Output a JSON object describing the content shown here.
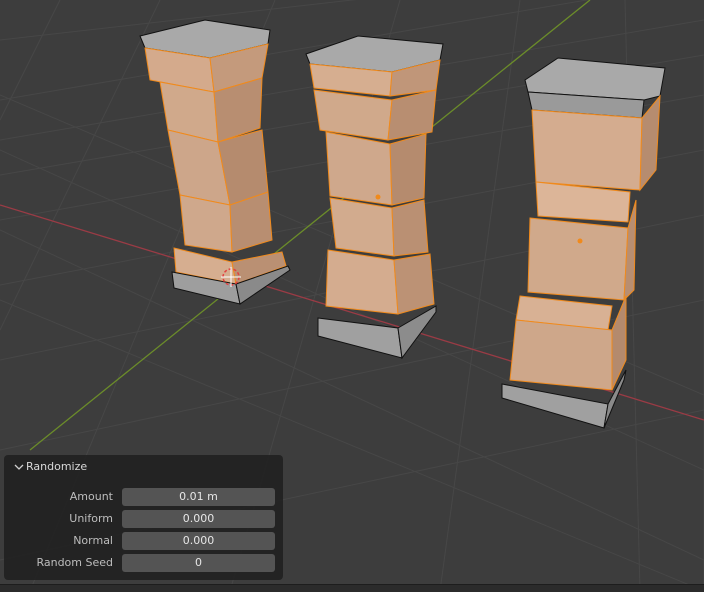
{
  "colors": {
    "viewport_bg": "#3d3d3d",
    "grid_line": "#474747",
    "x_axis": "#9a3b45",
    "y_axis": "#6b8c2a",
    "selection_orange": "#f08a1c",
    "mesh_face": "#c9a48a",
    "panel_bg": "#222222",
    "field_bg": "#545454"
  },
  "operator_panel": {
    "title": "Randomize",
    "collapse_icon": "chevron-down-icon",
    "properties": [
      {
        "label": "Amount",
        "value": "0.01 m"
      },
      {
        "label": "Uniform",
        "value": "0.000"
      },
      {
        "label": "Normal",
        "value": "0.000"
      },
      {
        "label": "Random Seed",
        "value": "0"
      }
    ]
  },
  "scene": {
    "objects": [
      "pillar",
      "pillar",
      "pillar"
    ],
    "cursor_icon": "3d-cursor-icon"
  }
}
